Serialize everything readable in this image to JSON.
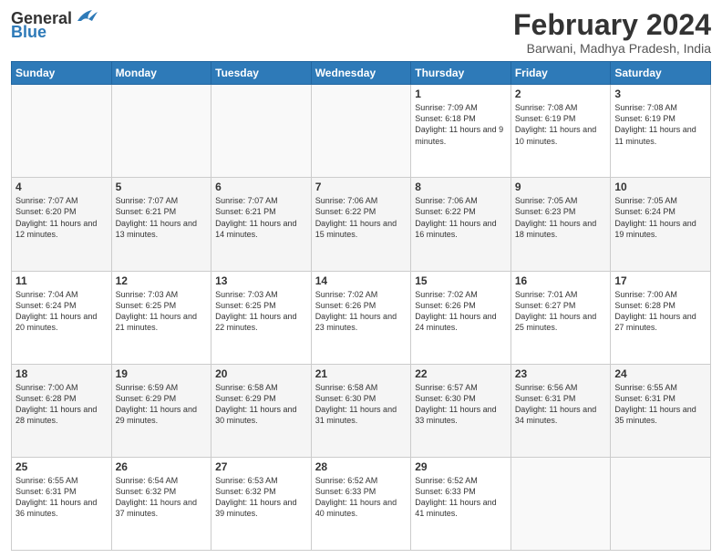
{
  "header": {
    "logo_general": "General",
    "logo_blue": "Blue",
    "title": "February 2024",
    "subtitle": "Barwani, Madhya Pradesh, India"
  },
  "days_of_week": [
    "Sunday",
    "Monday",
    "Tuesday",
    "Wednesday",
    "Thursday",
    "Friday",
    "Saturday"
  ],
  "weeks": [
    [
      {
        "day": "",
        "sunrise": "",
        "sunset": "",
        "daylight": ""
      },
      {
        "day": "",
        "sunrise": "",
        "sunset": "",
        "daylight": ""
      },
      {
        "day": "",
        "sunrise": "",
        "sunset": "",
        "daylight": ""
      },
      {
        "day": "",
        "sunrise": "",
        "sunset": "",
        "daylight": ""
      },
      {
        "day": "1",
        "sunrise": "Sunrise: 7:09 AM",
        "sunset": "Sunset: 6:18 PM",
        "daylight": "Daylight: 11 hours and 9 minutes."
      },
      {
        "day": "2",
        "sunrise": "Sunrise: 7:08 AM",
        "sunset": "Sunset: 6:19 PM",
        "daylight": "Daylight: 11 hours and 10 minutes."
      },
      {
        "day": "3",
        "sunrise": "Sunrise: 7:08 AM",
        "sunset": "Sunset: 6:19 PM",
        "daylight": "Daylight: 11 hours and 11 minutes."
      }
    ],
    [
      {
        "day": "4",
        "sunrise": "Sunrise: 7:07 AM",
        "sunset": "Sunset: 6:20 PM",
        "daylight": "Daylight: 11 hours and 12 minutes."
      },
      {
        "day": "5",
        "sunrise": "Sunrise: 7:07 AM",
        "sunset": "Sunset: 6:21 PM",
        "daylight": "Daylight: 11 hours and 13 minutes."
      },
      {
        "day": "6",
        "sunrise": "Sunrise: 7:07 AM",
        "sunset": "Sunset: 6:21 PM",
        "daylight": "Daylight: 11 hours and 14 minutes."
      },
      {
        "day": "7",
        "sunrise": "Sunrise: 7:06 AM",
        "sunset": "Sunset: 6:22 PM",
        "daylight": "Daylight: 11 hours and 15 minutes."
      },
      {
        "day": "8",
        "sunrise": "Sunrise: 7:06 AM",
        "sunset": "Sunset: 6:22 PM",
        "daylight": "Daylight: 11 hours and 16 minutes."
      },
      {
        "day": "9",
        "sunrise": "Sunrise: 7:05 AM",
        "sunset": "Sunset: 6:23 PM",
        "daylight": "Daylight: 11 hours and 18 minutes."
      },
      {
        "day": "10",
        "sunrise": "Sunrise: 7:05 AM",
        "sunset": "Sunset: 6:24 PM",
        "daylight": "Daylight: 11 hours and 19 minutes."
      }
    ],
    [
      {
        "day": "11",
        "sunrise": "Sunrise: 7:04 AM",
        "sunset": "Sunset: 6:24 PM",
        "daylight": "Daylight: 11 hours and 20 minutes."
      },
      {
        "day": "12",
        "sunrise": "Sunrise: 7:03 AM",
        "sunset": "Sunset: 6:25 PM",
        "daylight": "Daylight: 11 hours and 21 minutes."
      },
      {
        "day": "13",
        "sunrise": "Sunrise: 7:03 AM",
        "sunset": "Sunset: 6:25 PM",
        "daylight": "Daylight: 11 hours and 22 minutes."
      },
      {
        "day": "14",
        "sunrise": "Sunrise: 7:02 AM",
        "sunset": "Sunset: 6:26 PM",
        "daylight": "Daylight: 11 hours and 23 minutes."
      },
      {
        "day": "15",
        "sunrise": "Sunrise: 7:02 AM",
        "sunset": "Sunset: 6:26 PM",
        "daylight": "Daylight: 11 hours and 24 minutes."
      },
      {
        "day": "16",
        "sunrise": "Sunrise: 7:01 AM",
        "sunset": "Sunset: 6:27 PM",
        "daylight": "Daylight: 11 hours and 25 minutes."
      },
      {
        "day": "17",
        "sunrise": "Sunrise: 7:00 AM",
        "sunset": "Sunset: 6:28 PM",
        "daylight": "Daylight: 11 hours and 27 minutes."
      }
    ],
    [
      {
        "day": "18",
        "sunrise": "Sunrise: 7:00 AM",
        "sunset": "Sunset: 6:28 PM",
        "daylight": "Daylight: 11 hours and 28 minutes."
      },
      {
        "day": "19",
        "sunrise": "Sunrise: 6:59 AM",
        "sunset": "Sunset: 6:29 PM",
        "daylight": "Daylight: 11 hours and 29 minutes."
      },
      {
        "day": "20",
        "sunrise": "Sunrise: 6:58 AM",
        "sunset": "Sunset: 6:29 PM",
        "daylight": "Daylight: 11 hours and 30 minutes."
      },
      {
        "day": "21",
        "sunrise": "Sunrise: 6:58 AM",
        "sunset": "Sunset: 6:30 PM",
        "daylight": "Daylight: 11 hours and 31 minutes."
      },
      {
        "day": "22",
        "sunrise": "Sunrise: 6:57 AM",
        "sunset": "Sunset: 6:30 PM",
        "daylight": "Daylight: 11 hours and 33 minutes."
      },
      {
        "day": "23",
        "sunrise": "Sunrise: 6:56 AM",
        "sunset": "Sunset: 6:31 PM",
        "daylight": "Daylight: 11 hours and 34 minutes."
      },
      {
        "day": "24",
        "sunrise": "Sunrise: 6:55 AM",
        "sunset": "Sunset: 6:31 PM",
        "daylight": "Daylight: 11 hours and 35 minutes."
      }
    ],
    [
      {
        "day": "25",
        "sunrise": "Sunrise: 6:55 AM",
        "sunset": "Sunset: 6:31 PM",
        "daylight": "Daylight: 11 hours and 36 minutes."
      },
      {
        "day": "26",
        "sunrise": "Sunrise: 6:54 AM",
        "sunset": "Sunset: 6:32 PM",
        "daylight": "Daylight: 11 hours and 37 minutes."
      },
      {
        "day": "27",
        "sunrise": "Sunrise: 6:53 AM",
        "sunset": "Sunset: 6:32 PM",
        "daylight": "Daylight: 11 hours and 39 minutes."
      },
      {
        "day": "28",
        "sunrise": "Sunrise: 6:52 AM",
        "sunset": "Sunset: 6:33 PM",
        "daylight": "Daylight: 11 hours and 40 minutes."
      },
      {
        "day": "29",
        "sunrise": "Sunrise: 6:52 AM",
        "sunset": "Sunset: 6:33 PM",
        "daylight": "Daylight: 11 hours and 41 minutes."
      },
      {
        "day": "",
        "sunrise": "",
        "sunset": "",
        "daylight": ""
      },
      {
        "day": "",
        "sunrise": "",
        "sunset": "",
        "daylight": ""
      }
    ]
  ]
}
